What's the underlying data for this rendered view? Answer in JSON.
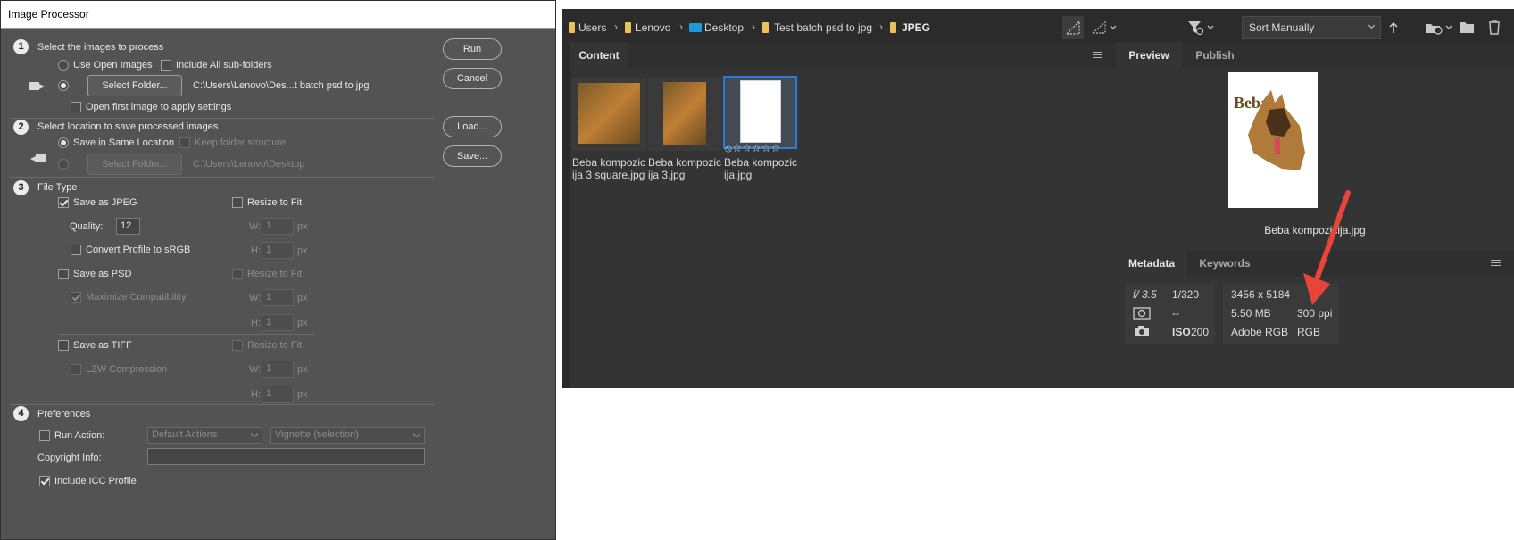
{
  "image_processor": {
    "title": "Image Processor",
    "section1": {
      "number": "1",
      "heading": "Select the images to process",
      "use_open_images": "Use Open Images",
      "include_subfolders": "Include All sub-folders",
      "select_folder_button": "Select Folder...",
      "folder_path": "C:\\Users\\Lenovo\\Des...t batch psd to jpg",
      "open_first_image": "Open first image to apply settings"
    },
    "section2": {
      "number": "2",
      "heading": "Select location to save processed images",
      "save_same_location": "Save in Same Location",
      "keep_folder_structure": "Keep folder structure",
      "select_folder_button": "Select Folder...",
      "folder_path": "C:\\Users\\Lenovo\\Desktop"
    },
    "section3": {
      "number": "3",
      "heading": "File Type",
      "save_as_jpeg": "Save as JPEG",
      "resize_to_fit": "Resize to Fit",
      "quality_label": "Quality:",
      "quality_value": "12",
      "convert_profile": "Convert Profile to sRGB",
      "w_label": "W:",
      "h_label": "H:",
      "dim_value": "1",
      "px": "px",
      "save_as_psd": "Save as PSD",
      "maximize_compat": "Maximize Compatibility",
      "save_as_tiff": "Save as TIFF",
      "lzw_compression": "LZW Compression"
    },
    "section4": {
      "number": "4",
      "heading": "Preferences",
      "run_action": "Run Action:",
      "action_set": "Default Actions",
      "action_name": "Vignette (selection)",
      "copyright_label": "Copyright Info:",
      "copyright_value": "",
      "include_icc": "Include ICC Profile"
    },
    "buttons": {
      "run": "Run",
      "cancel": "Cancel",
      "load": "Load...",
      "save": "Save..."
    }
  },
  "bridge": {
    "breadcrumbs": [
      "Users",
      "Lenovo",
      "Desktop",
      "Test batch psd to jpg",
      "JPEG"
    ],
    "sort": "Sort Manually",
    "content_tab": "Content",
    "preview_tab": "Preview",
    "publish_tab": "Publish",
    "metadata_tab": "Metadata",
    "keywords_tab": "Keywords",
    "thumbnails": [
      {
        "name": "Beba kompozic\nija 3 square.jpg"
      },
      {
        "name": "Beba kompozic\nija 3.jpg"
      },
      {
        "name": "Beba kompozic\nija.jpg",
        "rating": "⦸☆☆☆☆☆"
      }
    ],
    "preview_filename": "Beba kompozicija.jpg",
    "metadata": {
      "aperture": "f/ 3.5",
      "shutter": "1/320",
      "metering": "--",
      "iso_label": "ISO",
      "iso_value": "200",
      "dimensions": "3456 x 5184",
      "filesize": "5.50 MB",
      "resolution": "300 ppi",
      "profile": "Adobe RGB",
      "mode": "RGB"
    }
  },
  "colors": {
    "dialog_bg": "#535353",
    "bridge_bg": "#2b2b2b",
    "selection_blue": "#2d7bd6",
    "annotation_arrow": "#e8443a"
  }
}
